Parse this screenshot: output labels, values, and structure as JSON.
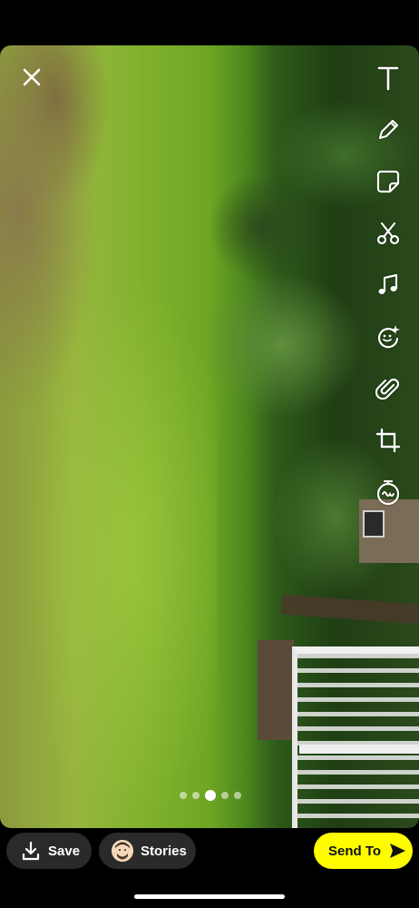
{
  "photo": {
    "description_icon": "photo-preview"
  },
  "top": {
    "close_icon": "close-icon"
  },
  "tools": [
    {
      "name": "text-tool",
      "icon": "text-icon"
    },
    {
      "name": "draw-tool",
      "icon": "pencil-icon"
    },
    {
      "name": "sticker-tool",
      "icon": "sticker-icon"
    },
    {
      "name": "scissors-tool",
      "icon": "scissors-icon"
    },
    {
      "name": "music-tool",
      "icon": "music-note-icon"
    },
    {
      "name": "lens-tool",
      "icon": "lens-sparkle-icon"
    },
    {
      "name": "attach-tool",
      "icon": "paperclip-icon"
    },
    {
      "name": "crop-tool",
      "icon": "crop-icon"
    },
    {
      "name": "timer-tool",
      "icon": "timer-icon"
    }
  ],
  "pager": {
    "total": 5,
    "active_index": 2
  },
  "bottom": {
    "save_label": "Save",
    "stories_label": "Stories",
    "send_label": "Send To"
  },
  "colors": {
    "send_button": "#fffc00",
    "pill_background": "#2a2a2a"
  }
}
